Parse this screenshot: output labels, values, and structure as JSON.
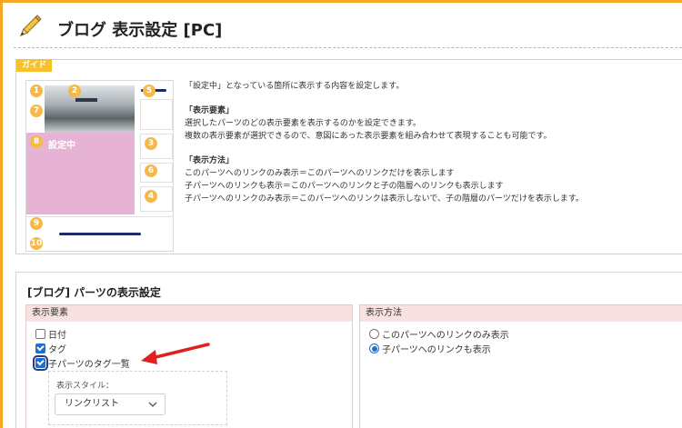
{
  "header": {
    "title": "ブログ 表示設定 [PC]",
    "icon": "pencil-icon"
  },
  "guide": {
    "tag": "ガイド",
    "setting_label": "設定中",
    "badges": [
      "1",
      "2",
      "5",
      "7",
      "8",
      "3",
      "6",
      "4",
      "9",
      "10"
    ],
    "lines": {
      "intro": "「設定中」となっている箇所に表示する内容を設定します。",
      "section1_title": "「表示要素」",
      "section1_line1": "選択したパーツのどの表示要素を表示するのかを設定できます。",
      "section1_line2": "複数の表示要素が選択できるので、意図にあった表示要素を組み合わせて表現することも可能です。",
      "section2_title": "「表示方法」",
      "section2_line1": "このパーツへのリンクのみ表示＝このパーツへのリンクだけを表示します",
      "section2_line2": "子パーツへのリンクも表示＝このパーツへのリンクと子の階層へのリンクも表示します",
      "section2_line3": "子パーツへのリンクのみ表示＝このパーツへのリンクは表示しないで、子の階層のパーツだけを表示します。"
    }
  },
  "panel": {
    "title": "[ブログ] パーツの表示設定",
    "elements": {
      "heading": "表示要素",
      "options": [
        {
          "label": "日付",
          "checked": false
        },
        {
          "label": "タグ",
          "checked": true
        },
        {
          "label": "子パーツのタグ一覧",
          "checked": true
        }
      ],
      "style_label": "表示スタイル：",
      "style_value": "リンクリスト"
    },
    "method": {
      "heading": "表示方法",
      "options": [
        {
          "label": "このパーツへのリンクのみ表示",
          "selected": false
        },
        {
          "label": "子パーツへのリンクも表示",
          "selected": true
        }
      ]
    }
  },
  "colors": {
    "accent": "#f5a623",
    "guide_tag": "#f6c22c",
    "badge": "#f5b94a",
    "highlight_area": "#e7b3d4",
    "column_header": "#f8e1e1",
    "checkbox_on": "#1f6fcf",
    "arrow": "#e02020"
  }
}
